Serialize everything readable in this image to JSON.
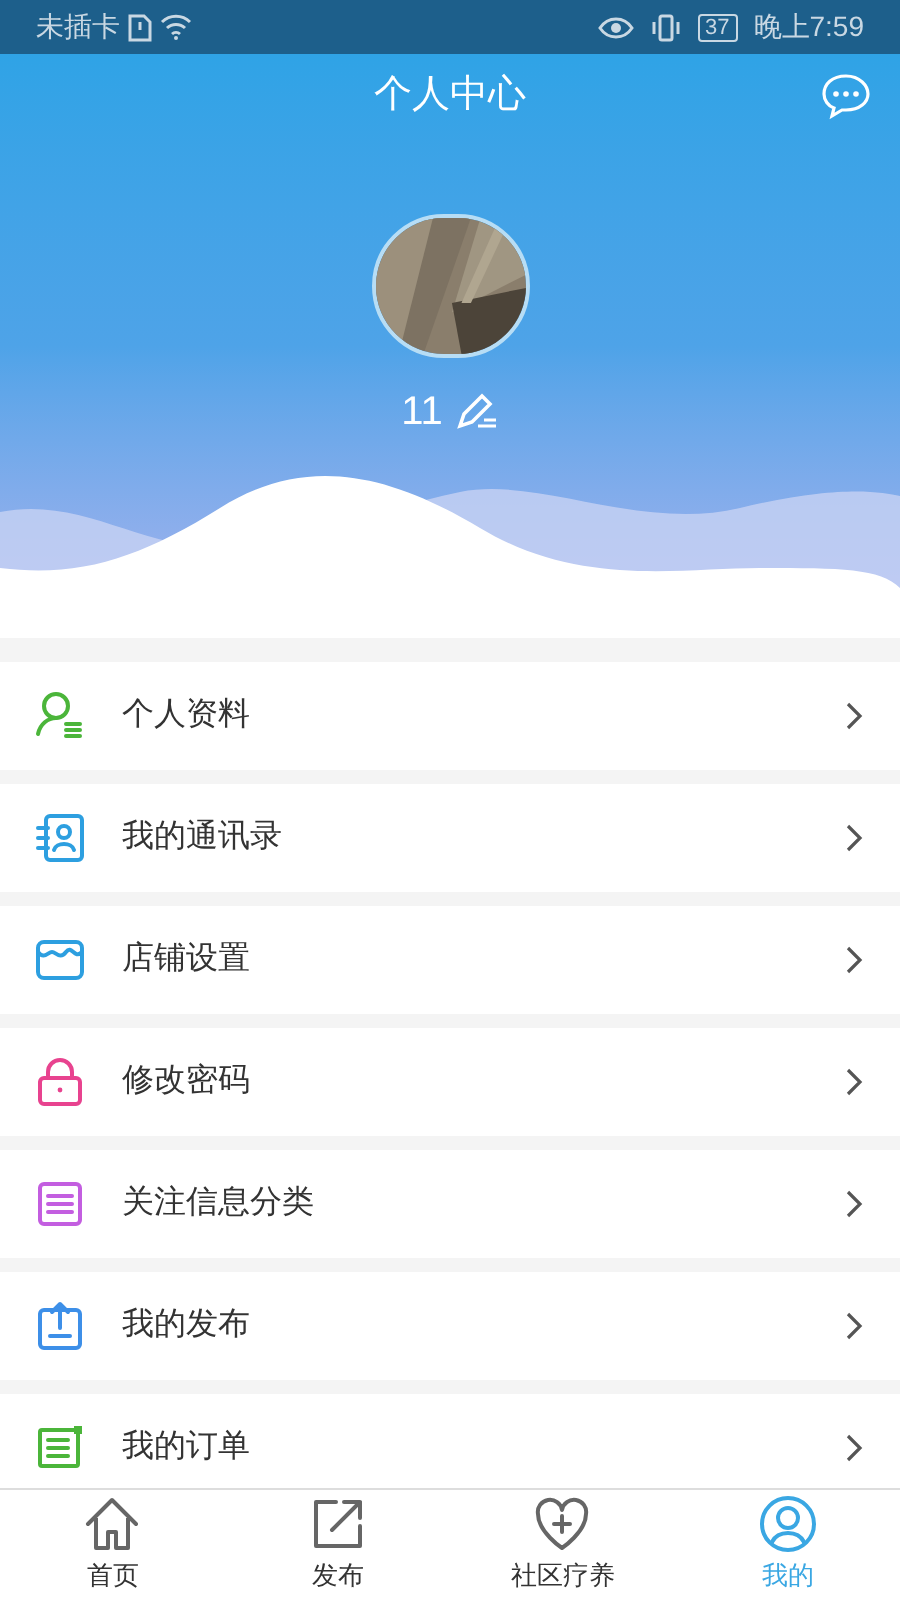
{
  "status_bar": {
    "carrier": "未插卡",
    "battery": "37",
    "time": "晚上7:59"
  },
  "header": {
    "title": "个人中心",
    "user_name": "11"
  },
  "menu": [
    {
      "label": "个人资料",
      "kind": "profile",
      "color": "#4bb53a"
    },
    {
      "label": "我的通讯录",
      "kind": "contacts",
      "color": "#2d9fe0"
    },
    {
      "label": "店铺设置",
      "kind": "shop",
      "color": "#2d9fe0"
    },
    {
      "label": "修改密码",
      "kind": "lock",
      "color": "#e8438f"
    },
    {
      "label": "关注信息分类",
      "kind": "list",
      "color": "#c35ee0"
    },
    {
      "label": "我的发布",
      "kind": "upload",
      "color": "#3d8fe8"
    },
    {
      "label": "我的订单",
      "kind": "order",
      "color": "#4bb53a"
    }
  ],
  "nav": [
    {
      "label": "首页",
      "kind": "home",
      "selected": false
    },
    {
      "label": "发布",
      "kind": "publish",
      "selected": false
    },
    {
      "label": "社区疗养",
      "kind": "health",
      "selected": false
    },
    {
      "label": "我的",
      "kind": "me",
      "selected": true
    }
  ]
}
